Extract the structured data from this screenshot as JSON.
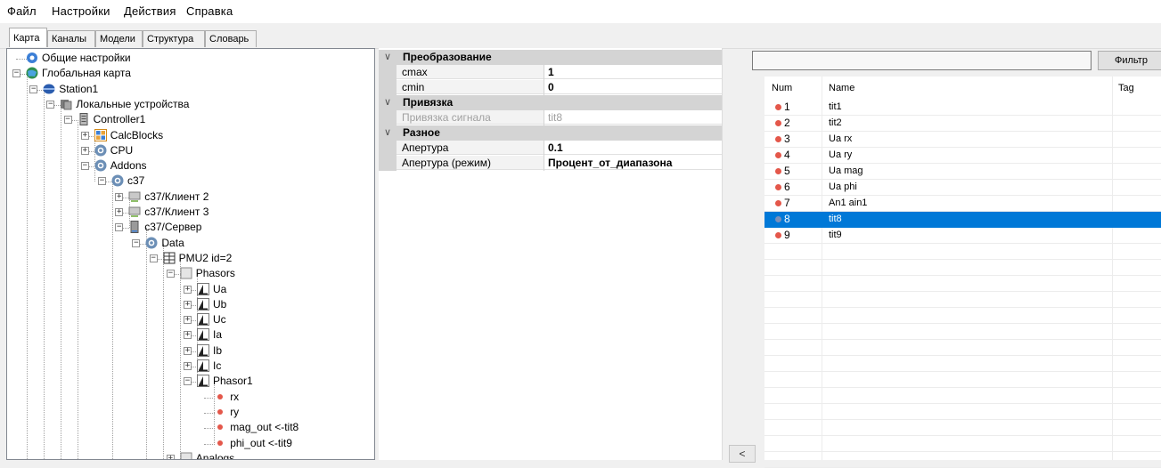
{
  "menu": [
    "Файл",
    "Настройки",
    "Действия",
    "Справка"
  ],
  "tabs": [
    {
      "label": "Карта",
      "active": true
    },
    {
      "label": "Каналы",
      "active": false
    },
    {
      "label": "Модели",
      "active": false
    },
    {
      "label": "Структура",
      "active": false
    },
    {
      "label": "Словарь",
      "active": false
    }
  ],
  "tree": {
    "nodes": [
      {
        "label": "Общие настройки",
        "icon": "settings-info-icon"
      },
      {
        "label": "Глобальная карта",
        "icon": "globe-icon"
      },
      {
        "label": "Station1",
        "icon": "station-icon"
      },
      {
        "label": "Локальные устройства",
        "icon": "devices-icon"
      },
      {
        "label": "Controller1",
        "icon": "controller-icon"
      },
      {
        "label": "CalcBlocks",
        "icon": "calcblocks-icon"
      },
      {
        "label": "CPU",
        "icon": "gear-icon"
      },
      {
        "label": "Addons",
        "icon": "gear-icon"
      },
      {
        "label": "c37",
        "icon": "gear-icon"
      },
      {
        "label": "c37/Клиент 2",
        "icon": "network-client-icon"
      },
      {
        "label": "c37/Клиент 3",
        "icon": "network-client-icon"
      },
      {
        "label": "c37/Сервер",
        "icon": "server-icon"
      },
      {
        "label": "Data",
        "icon": "gear-icon"
      },
      {
        "label": "PMU2 id=2",
        "icon": "table-icon"
      },
      {
        "label": "Phasors",
        "icon": "folder-icon"
      },
      {
        "label": "Ua",
        "icon": "phasor-icon"
      },
      {
        "label": "Ub",
        "icon": "phasor-icon"
      },
      {
        "label": "Uc",
        "icon": "phasor-icon"
      },
      {
        "label": "Ia",
        "icon": "phasor-icon"
      },
      {
        "label": "Ib",
        "icon": "phasor-icon"
      },
      {
        "label": "Ic",
        "icon": "phasor-icon"
      },
      {
        "label": "Phasor1",
        "icon": "phasor-icon"
      },
      {
        "label": "rx",
        "icon": "signal-dot-icon"
      },
      {
        "label": "ry",
        "icon": "signal-dot-icon"
      },
      {
        "label": "mag_out <-tit8",
        "icon": "signal-dot-icon"
      },
      {
        "label": "phi_out <-tit9",
        "icon": "signal-dot-icon"
      },
      {
        "label": "Analogs",
        "icon": "folder-icon"
      }
    ]
  },
  "props": {
    "categories": [
      {
        "label": "Преобразование",
        "rows": [
          {
            "name": "cmax",
            "value": "1",
            "disabled": false
          },
          {
            "name": "cmin",
            "value": "0",
            "disabled": false
          }
        ]
      },
      {
        "label": "Привязка",
        "rows": [
          {
            "name": "Привязка сигнала",
            "value": "tit8",
            "disabled": true
          }
        ]
      },
      {
        "label": "Разное",
        "rows": [
          {
            "name": "Апертура",
            "value": "0.1",
            "disabled": false
          },
          {
            "name": "Апертура (режим)",
            "value": "Процент_от_диапазона",
            "disabled": false
          }
        ]
      }
    ]
  },
  "splitter_label": "<",
  "filter": {
    "value": "",
    "button_label": "Фильтр"
  },
  "list": {
    "columns": [
      "Num",
      "Name",
      "Tag"
    ],
    "rows": [
      {
        "num": "1",
        "name": "tit1",
        "tag": "",
        "selected": false
      },
      {
        "num": "2",
        "name": "tit2",
        "tag": "",
        "selected": false
      },
      {
        "num": "3",
        "name": "Ua rx",
        "tag": "",
        "selected": false
      },
      {
        "num": "4",
        "name": "Ua ry",
        "tag": "",
        "selected": false
      },
      {
        "num": "5",
        "name": "Ua mag",
        "tag": "",
        "selected": false
      },
      {
        "num": "6",
        "name": "Ua phi",
        "tag": "",
        "selected": false
      },
      {
        "num": "7",
        "name": "An1 ain1",
        "tag": "",
        "selected": false
      },
      {
        "num": "8",
        "name": "tit8",
        "tag": "",
        "selected": true
      },
      {
        "num": "9",
        "name": "tit9",
        "tag": "",
        "selected": false
      }
    ]
  },
  "colors": {
    "selection": "#0078d7",
    "signal_dot": "#e4574a",
    "category_bg": "#d4d4d4"
  }
}
